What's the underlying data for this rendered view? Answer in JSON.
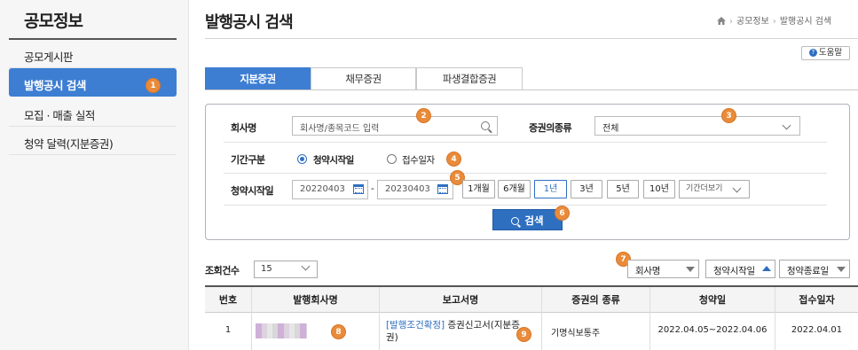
{
  "sidebar": {
    "title": "공모정보",
    "items": [
      {
        "label": "공모게시판"
      },
      {
        "label": "발행공시 검색",
        "badge": "1"
      },
      {
        "label": "모집 · 매출 실적"
      },
      {
        "label": "청약 달력(지분증권)"
      }
    ]
  },
  "header": {
    "title": "발행공시 검색",
    "breadcrumb": [
      "공모정보",
      "발행공시 검색"
    ],
    "help_label": "도움말"
  },
  "tabs": [
    {
      "label": "지분증권",
      "active": true
    },
    {
      "label": "채무증권",
      "active": false
    },
    {
      "label": "파생결합증권",
      "active": false
    }
  ],
  "search": {
    "company_label": "회사명",
    "company_placeholder": "회사명/종목코드 입력",
    "company_badge": "2",
    "security_type_label": "증권의종류",
    "security_type_value": "전체",
    "security_type_badge": "3",
    "period_label": "기간구분",
    "period_options": [
      "청약시작일",
      "접수일자"
    ],
    "period_selected": "청약시작일",
    "period_badge": "4",
    "date_label": "청약시작일",
    "date_from": "20220403",
    "date_sep": "-",
    "date_to": "20230403",
    "date_badge": "5",
    "quick_periods": [
      "1개월",
      "6개월",
      "1년",
      "3년",
      "5년",
      "10년"
    ],
    "quick_selected": "1년",
    "more_periods_label": "기간더보기",
    "search_button_label": "검색",
    "search_badge": "6"
  },
  "results": {
    "count_label": "조회건수",
    "count_value": "15",
    "sort_badge": "7",
    "sort_options": [
      {
        "label": "회사명",
        "arrow": "down"
      },
      {
        "label": "청약시작일",
        "arrow": "up"
      },
      {
        "label": "청약종료일",
        "arrow": "down"
      }
    ],
    "columns": [
      "번호",
      "발행회사명",
      "보고서명",
      "증권의 종류",
      "청약일",
      "접수일자"
    ],
    "rows": [
      {
        "no": "1",
        "company_badge": "8",
        "report_tag": "[발행조건확정]",
        "report_name_1": " 증권신고서(지분증",
        "report_name_2": "권)",
        "report_badge": "9",
        "security_type": "기명식보통주",
        "subscription": "2022.04.05~2022.04.06",
        "received": "2022.04.01"
      }
    ]
  },
  "colors": {
    "accent": "#3d7ed3",
    "badge": "#e98b3a"
  }
}
